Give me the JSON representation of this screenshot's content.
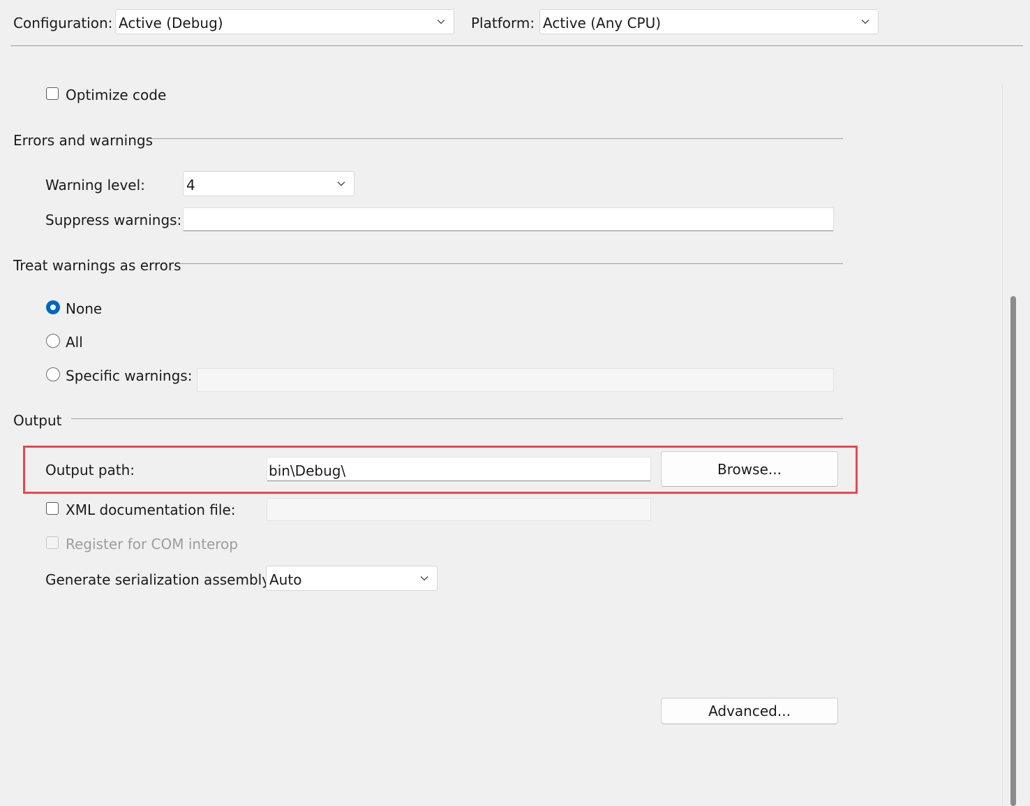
{
  "header": {
    "configuration_label": "Configuration:",
    "configuration_value": "Active (Debug)",
    "platform_label": "Platform:",
    "platform_value": "Active (Any CPU)"
  },
  "general": {
    "optimize_code_label": "Optimize code",
    "optimize_code_checked": false
  },
  "errors_and_warnings": {
    "section_title": "Errors and warnings",
    "warning_level_label": "Warning level:",
    "warning_level_value": "4",
    "suppress_warnings_label": "Suppress warnings:",
    "suppress_warnings_value": ""
  },
  "treat_warnings_as_errors": {
    "section_title": "Treat warnings as errors",
    "options": [
      {
        "label": "None",
        "selected": true
      },
      {
        "label": "All",
        "selected": false
      },
      {
        "label": "Specific warnings:",
        "selected": false
      }
    ],
    "specific_warnings_value": ""
  },
  "output": {
    "section_title": "Output",
    "output_path_label": "Output path:",
    "output_path_value": "bin\\Debug\\",
    "browse_button_label": "Browse...",
    "xml_doc_label": "XML documentation file:",
    "xml_doc_checked": false,
    "xml_doc_value": "",
    "com_interop_label": "Register for COM interop",
    "com_interop_enabled": false,
    "serialization_label": "Generate serialization assembly:",
    "serialization_value": "Auto"
  },
  "footer": {
    "advanced_button_label": "Advanced..."
  },
  "colors": {
    "highlight_box": "#e8474c",
    "radio_accent": "#0067c0",
    "background": "#f0f0f0"
  }
}
